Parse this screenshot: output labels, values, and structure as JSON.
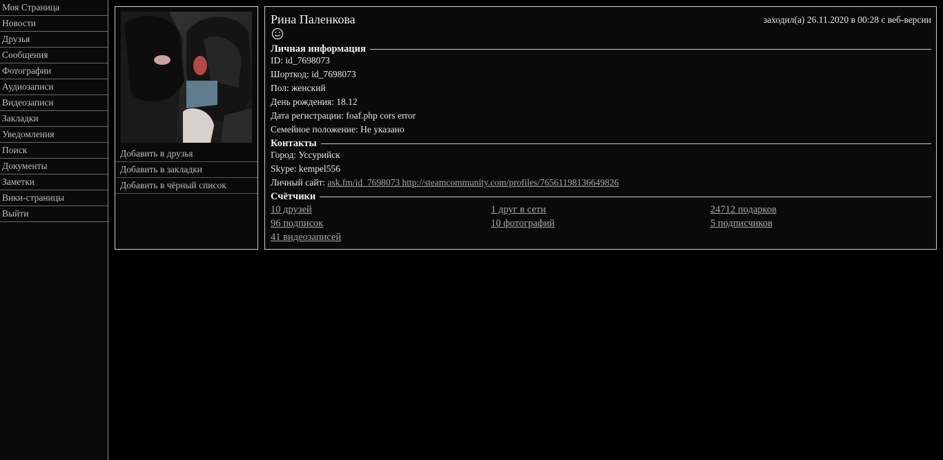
{
  "sidebar": {
    "items": [
      {
        "label": "Моя Страница"
      },
      {
        "label": "Новости"
      },
      {
        "label": "Друзья"
      },
      {
        "label": "Сообщения"
      },
      {
        "label": "Фотографии"
      },
      {
        "label": "Аудиозаписи"
      },
      {
        "label": "Видеозаписи"
      },
      {
        "label": "Закладки"
      },
      {
        "label": "Уведомления"
      },
      {
        "label": "Поиск"
      },
      {
        "label": "Документы"
      },
      {
        "label": "Заметки"
      },
      {
        "label": "Вики-страницы"
      },
      {
        "label": "Выйти"
      }
    ]
  },
  "profile": {
    "name": "Рина Паленкова",
    "last_seen": "заходил(а) 26.11.2020 в 00:28 с веб-версии",
    "status_icon": "smiley-icon",
    "actions": [
      {
        "label": "Добавить в друзья"
      },
      {
        "label": "Добавить в закладки"
      },
      {
        "label": "Добавить в чёрный список"
      }
    ]
  },
  "personal": {
    "title": "Личная информация",
    "id": "ID: id_7698073",
    "shortcode": "Шорткод: id_7698073",
    "gender": "Пол: женский",
    "birthday": "День рождения: 18.12",
    "registration": "Дата регистрации: foaf.php cors error",
    "relationship": "Семейное положение: Не указано"
  },
  "contacts": {
    "title": "Контакты",
    "city": "Город: Уссурийск",
    "skype": "Skype: kempel556",
    "site_label": "Личный сайт: ",
    "site_link": "ask.fm/id_7698073 http://steamcommunity.com/profiles/76561198136649826"
  },
  "counters": {
    "title": "Счётчики",
    "friends": "10 друзей",
    "online": "1 друг в сети",
    "gifts": "24712 подарков",
    "subscriptions": "96 подписок",
    "photos": "10 фотографий",
    "followers": "5 подписчиков",
    "videos": "41 видеозаписей"
  },
  "colors": {
    "background": "#000000",
    "panel": "#0a0a0a",
    "border": "#cfcfcf",
    "text": "#e6e6e6",
    "link": "#a8a8a8"
  }
}
